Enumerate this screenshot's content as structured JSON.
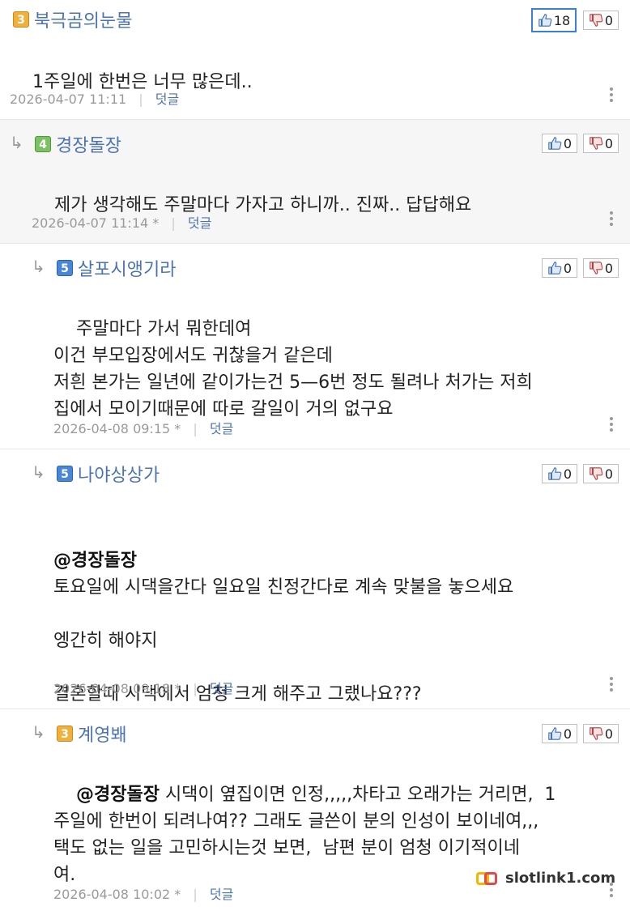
{
  "comments": [
    {
      "level": "3",
      "nickname": "북극곰의눈물",
      "likes": "18",
      "dislikes": "0",
      "mention": "",
      "body": "1주일에 한번은 너무 많은데..",
      "date": "2026-04-07 11:11",
      "edited": "",
      "reply_label": "덧글"
    },
    {
      "level": "4",
      "nickname": "경장돌장",
      "likes": "0",
      "dislikes": "0",
      "mention": "",
      "body": "제가 생각해도 주말마다 가자고 하니까.. 진짜.. 답답해요",
      "date": "2026-04-07 11:14",
      "edited": "*",
      "reply_label": "덧글"
    },
    {
      "level": "5",
      "nickname": "살포시앵기라",
      "likes": "0",
      "dislikes": "0",
      "mention": "",
      "body": "주말마다 가서 뭐한데여\n이건 부모입장에서도 귀찮을거 같은데\n저흰 본가는 일년에 같이가는건 5—6번 정도 될려나 처가는 저희\n집에서 모이기때문에 따로 갈일이 거의 없구요",
      "date": "2026-04-08 09:15",
      "edited": "*",
      "reply_label": "덧글"
    },
    {
      "level": "5",
      "nickname": "나야상상가",
      "likes": "0",
      "dislikes": "0",
      "mention": "@경장돌장",
      "body": "토요일에 시댁을간다 일요일 친정간다로 계속 맞불을 놓으세요\n\n엥간히 해야지\n\n결혼할때 시댁에서 엄청 크게 해주고 그랬나요???",
      "date": "2026-04-08 09:18",
      "edited": "*",
      "reply_label": "덧글"
    },
    {
      "level": "3",
      "nickname": "계영봬",
      "likes": "0",
      "dislikes": "0",
      "mention": "@경장돌장",
      "body": " 시댁이 옆집이면 인정,,,,,차타고 오래가는 거리면,  1\n주일에 한번이 되려나여?? 그래도 글쓴이 분의 인성이 보이네여,,,\n택도 없는 일을 고민하시는것 보면,  남편 분이 엄청 이기적이네\n여.",
      "date": "2026-04-08 10:02",
      "edited": "*",
      "reply_label": "덧글"
    }
  ],
  "watermark": "slotlink1.com",
  "icons": {
    "reply": "reply-arrow-icon",
    "like": "thumbs-up-icon",
    "dislike": "thumbs-down-icon",
    "more": "more-vertical-icon"
  },
  "colors": {
    "nickname": "#4b73b4",
    "reply_bg": "#f6f6f6",
    "active_vote_border": "#3a7fd5"
  }
}
